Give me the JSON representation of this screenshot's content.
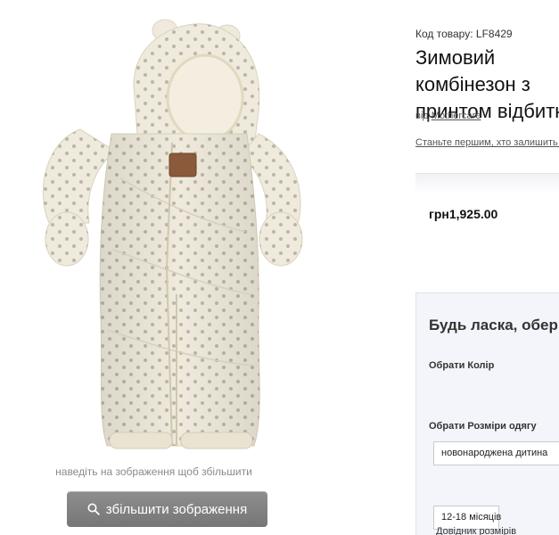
{
  "product": {
    "sku": "Код товару: LF8429",
    "title": "Зимовий комбінезон з принтом відбитків",
    "by_prefix": "від",
    "brand": "Mothercare",
    "review_link": "Станьте першим, хто залишить відгук",
    "price": "грн1,925.00"
  },
  "gallery": {
    "hint": "наведіть на зображення щоб збільшити",
    "zoom_button": "збільшити зображення",
    "zoom_icon": "magnifier-icon"
  },
  "options": {
    "heading": "Будь ласка, оберіть",
    "colour_label": "Обрати Колір",
    "size_label": "Обрати Розміри одягу",
    "sizes": [
      "новонароджена дитина",
      "12-18 місяців"
    ],
    "size_guide": "Довідник розмірів"
  },
  "colors": {
    "garment": "#efeadb",
    "polka_dot": "#b9b6ab",
    "button_bg": "#828282",
    "panel_bg": "#f4f5fa"
  }
}
